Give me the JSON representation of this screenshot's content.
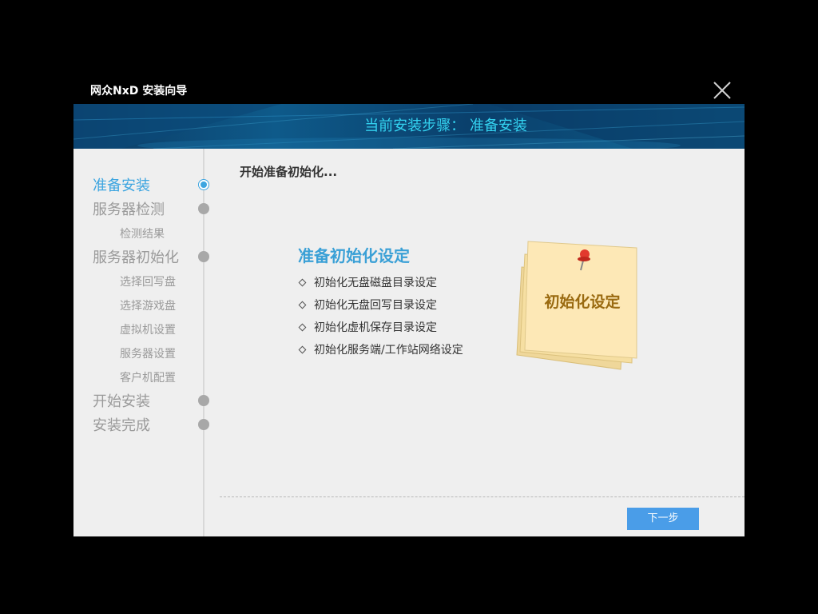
{
  "window": {
    "title": "网众NxD 安装向导"
  },
  "banner": {
    "text": "当前安装步骤： 准备安装"
  },
  "sidebar": {
    "steps": [
      {
        "label": "准备安装",
        "active": true
      },
      {
        "label": "服务器检测",
        "subs": [
          "检测结果"
        ]
      },
      {
        "label": "服务器初始化",
        "subs": [
          "选择回写盘",
          "选择游戏盘",
          "虚拟机设置",
          "服务器设置",
          "客户机配置"
        ]
      },
      {
        "label": "开始安装"
      },
      {
        "label": "安装完成"
      }
    ]
  },
  "main": {
    "header": "开始准备初始化...",
    "section_title": "准备初始化设定",
    "items": [
      "初始化无盘磁盘目录设定",
      "初始化无盘回写目录设定",
      "初始化虚机保存目录设定",
      "初始化服务端/工作站网络设定"
    ],
    "note_text": "初始化设定"
  },
  "footer": {
    "next_label": "下一步"
  },
  "colors": {
    "accent": "#3da5e0",
    "button": "#4a9de8",
    "banner_text": "#33d2f0",
    "note_text": "#9a6a10"
  }
}
